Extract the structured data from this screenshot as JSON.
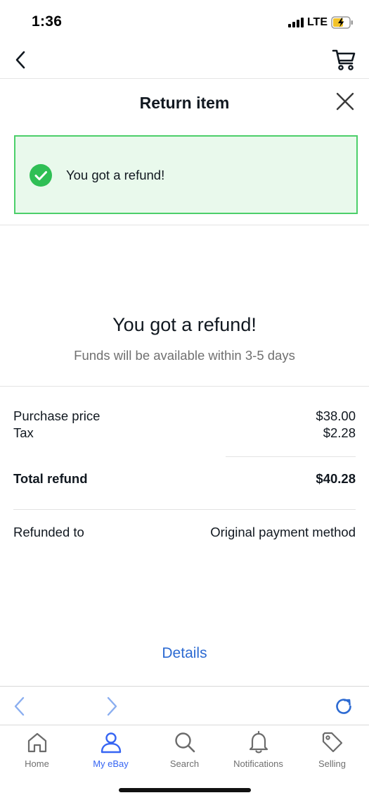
{
  "status_bar": {
    "time": "1:36",
    "network": "LTE"
  },
  "header": {
    "title": "Return item"
  },
  "banner": {
    "message": "You got a refund!"
  },
  "hero": {
    "title": "You got a refund!",
    "subtitle": "Funds will be available within 3-5 days"
  },
  "summary": {
    "purchase_price_label": "Purchase price",
    "purchase_price_value": "$38.00",
    "tax_label": "Tax",
    "tax_value": "$2.28",
    "total_label": "Total refund",
    "total_value": "$40.28",
    "refunded_to_label": "Refunded to",
    "refunded_to_value": "Original payment method"
  },
  "details_link": "Details",
  "tabs": [
    {
      "label": "Home",
      "icon": "home-icon"
    },
    {
      "label": "My eBay",
      "icon": "person-icon"
    },
    {
      "label": "Search",
      "icon": "search-icon"
    },
    {
      "label": "Notifications",
      "icon": "bell-icon"
    },
    {
      "label": "Selling",
      "icon": "tag-icon"
    }
  ],
  "colors": {
    "accent": "#3665f3",
    "link": "#2c6ad2",
    "success_border": "#4ccf6a",
    "success_background": "#e9f9ec",
    "success_icon": "#2fbf55",
    "browser_controls": "#8aaef0",
    "refresh": "#2c6ad2"
  }
}
